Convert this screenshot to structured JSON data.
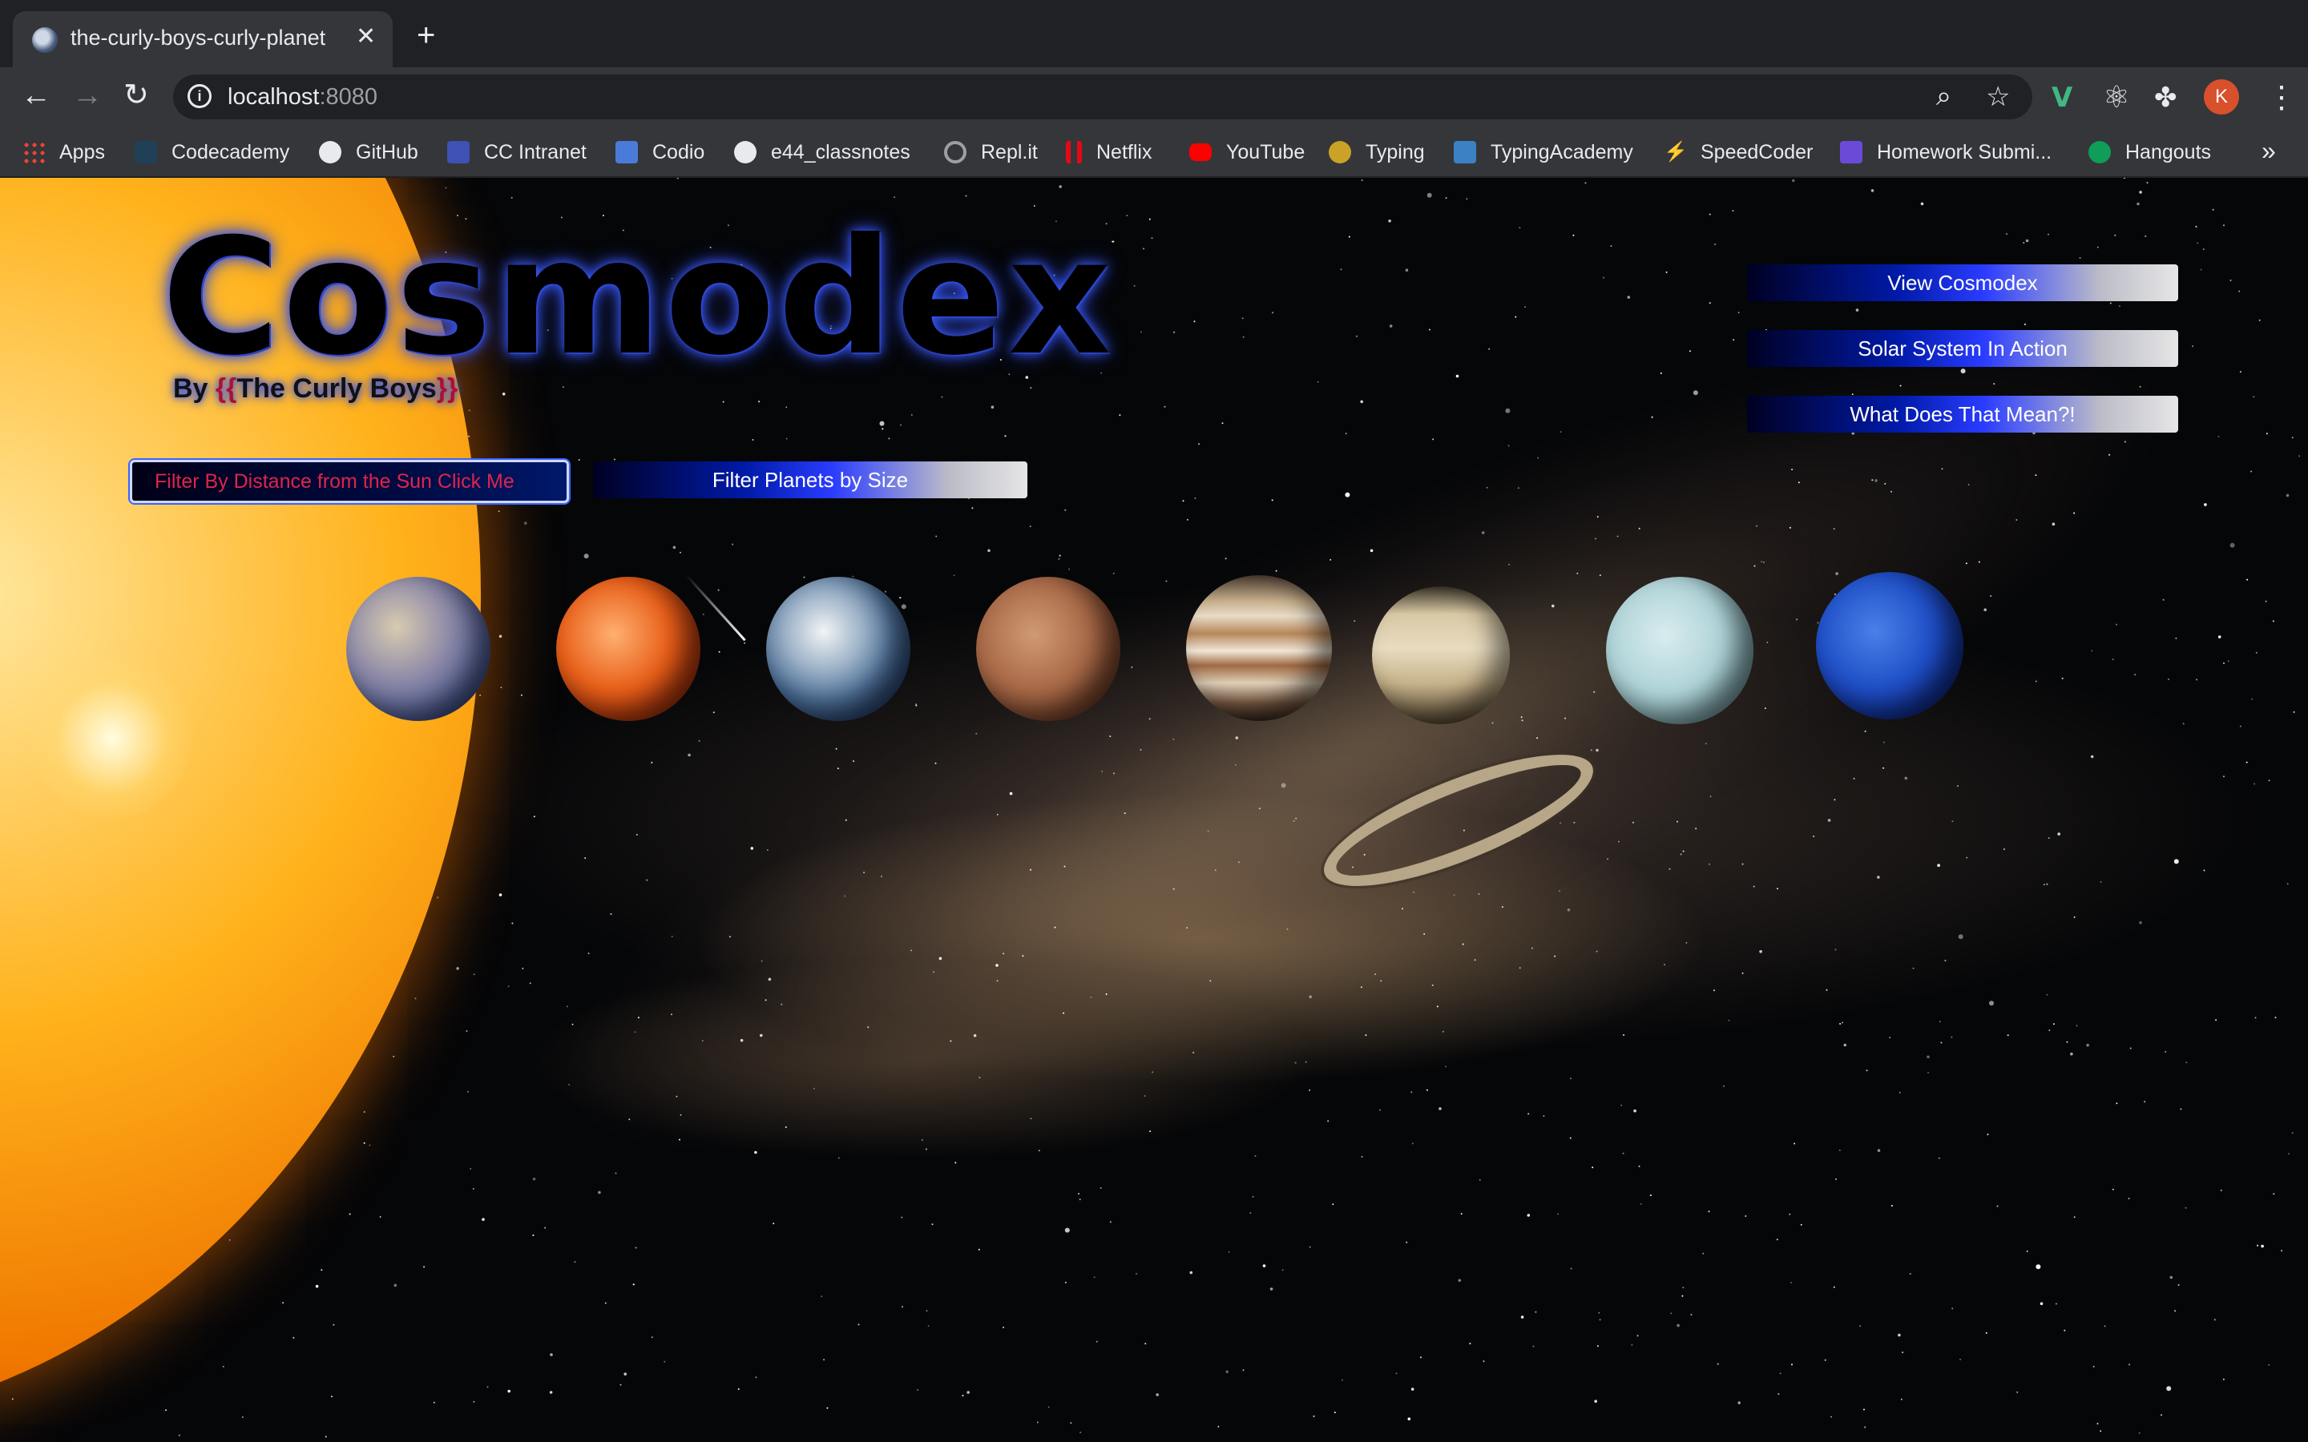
{
  "browser": {
    "tab_title": "the-curly-boys-curly-planet",
    "tab_close": "✕",
    "new_tab": "+",
    "url_host": "localhost",
    "url_port": ":8080",
    "avatar_letter": "K",
    "overflow": "»",
    "bookmarks": [
      {
        "label": "Apps",
        "icon": "apps-grid-icon",
        "color": "#ea4335"
      },
      {
        "label": "Codecademy",
        "icon": "codecademy-icon",
        "color": "#1f4056"
      },
      {
        "label": "GitHub",
        "icon": "github-icon",
        "color": "#e8eaed"
      },
      {
        "label": "CC Intranet",
        "icon": "cc-intranet-icon",
        "color": "#3f51b5"
      },
      {
        "label": "Codio",
        "icon": "codio-icon",
        "color": "#4a7bd8"
      },
      {
        "label": "e44_classnotes",
        "icon": "github-icon",
        "color": "#e8eaed"
      },
      {
        "label": "Repl.it",
        "icon": "replit-icon",
        "color": "#9aa0a6"
      },
      {
        "label": "Netflix",
        "icon": "netflix-icon",
        "color": "#e50914"
      },
      {
        "label": "YouTube",
        "icon": "youtube-icon",
        "color": "#ff0000"
      },
      {
        "label": "Typing",
        "icon": "typing-icon",
        "color": "#c9a227"
      },
      {
        "label": "TypingAcademy",
        "icon": "typingacademy-icon",
        "color": "#3b82c4"
      },
      {
        "label": "SpeedCoder",
        "icon": "speedcoder-icon",
        "color": "#1a1a1a"
      },
      {
        "label": "Homework Submi...",
        "icon": "homework-icon",
        "color": "#6a4bd8"
      },
      {
        "label": "Hangouts",
        "icon": "hangouts-icon",
        "color": "#0f9d58"
      }
    ]
  },
  "page": {
    "logo": "Cosmodex",
    "byline_prefix": "By ",
    "brace_open": "{{",
    "byline_name": "The Curly Boys",
    "brace_close": "}}",
    "filter_distance_text": "Filter By Distance from the Sun Click Me",
    "filter_size_label": "Filter Planets by Size",
    "nav": {
      "view_cosmodex": "View Cosmodex",
      "solar_system": "Solar System In Action",
      "what_does_that_mean": "What Does That Mean?!"
    },
    "planets": [
      "mercury",
      "venus",
      "earth",
      "mars",
      "jupiter",
      "saturn",
      "uranus",
      "neptune"
    ]
  }
}
